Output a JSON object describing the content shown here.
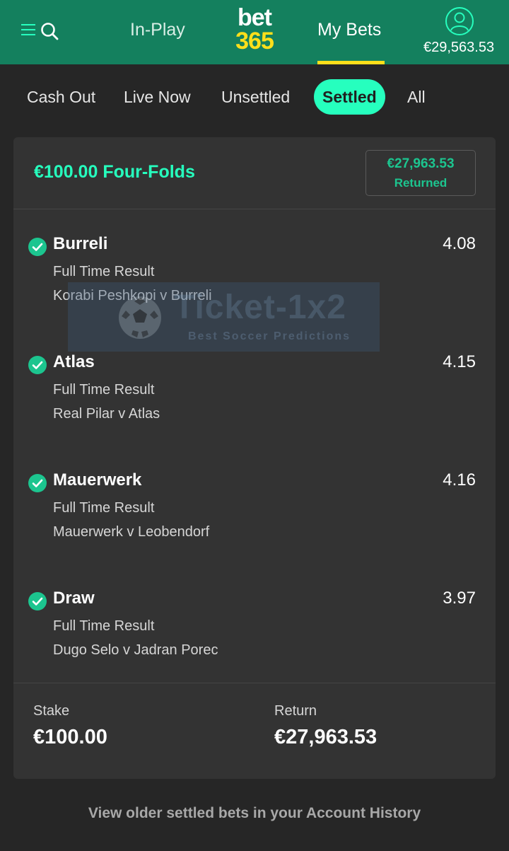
{
  "header": {
    "nav_inplay": "In-Play",
    "logo_top": "bet",
    "logo_bottom": "365",
    "nav_mybets": "My Bets",
    "balance": "€29,563.53",
    "icons": [
      "menu-icon",
      "search-icon",
      "account-icon"
    ]
  },
  "tabs": [
    {
      "label": "Cash Out",
      "active": false
    },
    {
      "label": "Live Now",
      "active": false
    },
    {
      "label": "Unsettled",
      "active": false
    },
    {
      "label": "Settled",
      "active": true
    },
    {
      "label": "All",
      "active": false
    }
  ],
  "bet": {
    "title": "€100.00 Four-Folds",
    "returned_amount": "€27,963.53",
    "returned_label": "Returned",
    "selections": [
      {
        "name": "Burreli",
        "odds": "4.08",
        "market": "Full Time Result",
        "event": "Korabi Peshkopi v Burreli"
      },
      {
        "name": "Atlas",
        "odds": "4.15",
        "market": "Full Time Result",
        "event": "Real Pilar v Atlas"
      },
      {
        "name": "Mauerwerk",
        "odds": "4.16",
        "market": "Full Time Result",
        "event": "Mauerwerk v Leobendorf"
      },
      {
        "name": "Draw",
        "odds": "3.97",
        "market": "Full Time Result",
        "event": "Dugo Selo v Jadran Porec"
      }
    ],
    "stake_label": "Stake",
    "stake_value": "€100.00",
    "return_label": "Return",
    "return_value": "€27,963.53"
  },
  "watermark": {
    "title": "Ticket-1x2",
    "subtitle": "Best Soccer Predictions"
  },
  "footer": {
    "history_link": "View older settled bets in your Account History"
  },
  "colors": {
    "header_bg": "#14805e",
    "accent": "#26ffbe",
    "won_green": "#1cc58f",
    "logo_yellow": "#ffdf1b",
    "page_bg": "#262626",
    "card_bg": "#333333"
  }
}
